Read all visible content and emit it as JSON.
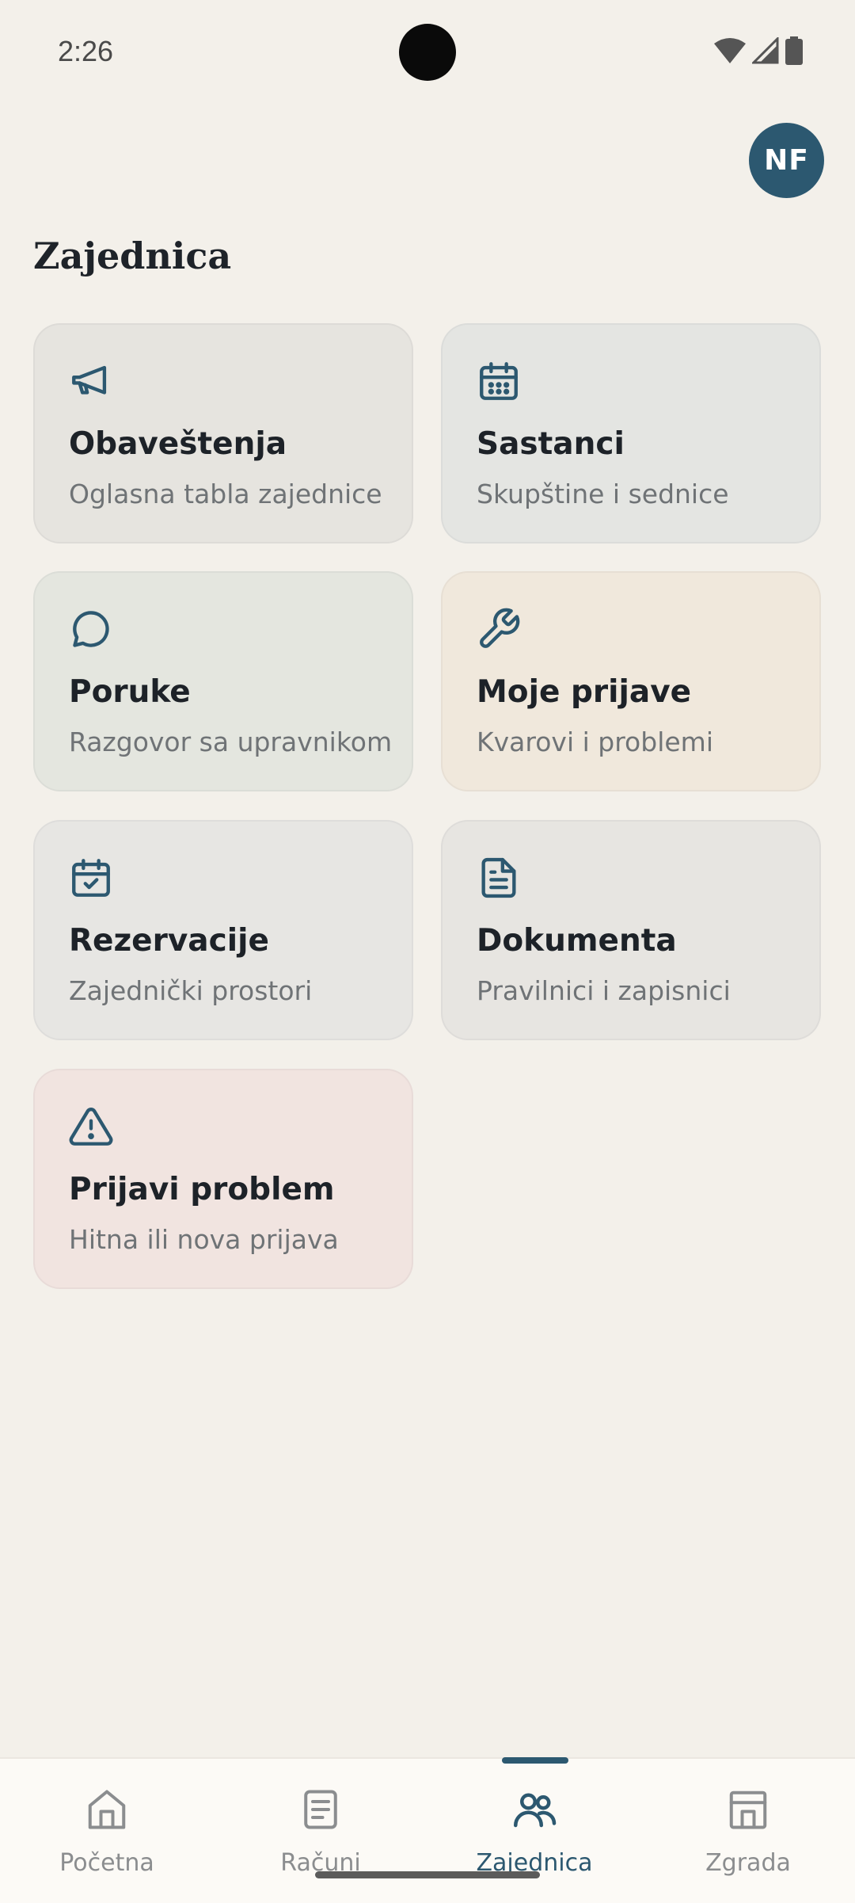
{
  "status_bar": {
    "time": "2:26",
    "icons": [
      "wifi-icon",
      "cell-signal-icon",
      "battery-icon"
    ]
  },
  "header": {
    "avatar_initials": "NF",
    "page_title": "Zajednica"
  },
  "cards": [
    {
      "icon": "megaphone-icon",
      "title": "Obaveštenja",
      "subtitle": "Oglasna tabla zajednice"
    },
    {
      "icon": "calendar-icon",
      "title": "Sastanci",
      "subtitle": "Skupštine i sednice"
    },
    {
      "icon": "chat-bubble-icon",
      "title": "Poruke",
      "subtitle": "Razgovor sa upravnikom"
    },
    {
      "icon": "wrench-icon",
      "title": "Moje prijave",
      "subtitle": "Kvarovi i problemi"
    },
    {
      "icon": "calendar-check-icon",
      "title": "Rezervacije",
      "subtitle": "Zajednički prostori"
    },
    {
      "icon": "document-icon",
      "title": "Dokumenta",
      "subtitle": "Pravilnici i zapisnici"
    },
    {
      "icon": "warning-icon",
      "title": "Prijavi problem",
      "subtitle": "Hitna ili nova prijava"
    }
  ],
  "bottom_nav": {
    "items": [
      {
        "icon": "home-icon",
        "label": "Početna",
        "active": false
      },
      {
        "icon": "receipt-icon",
        "label": "Računi",
        "active": false
      },
      {
        "icon": "people-icon",
        "label": "Zajednica",
        "active": true
      },
      {
        "icon": "building-icon",
        "label": "Zgrada",
        "active": false
      }
    ]
  },
  "colors": {
    "accent": "#2c5870",
    "background": "#f3f0ea",
    "nav_background": "#fcfaf6",
    "inactive_nav": "#8b8d8f"
  }
}
